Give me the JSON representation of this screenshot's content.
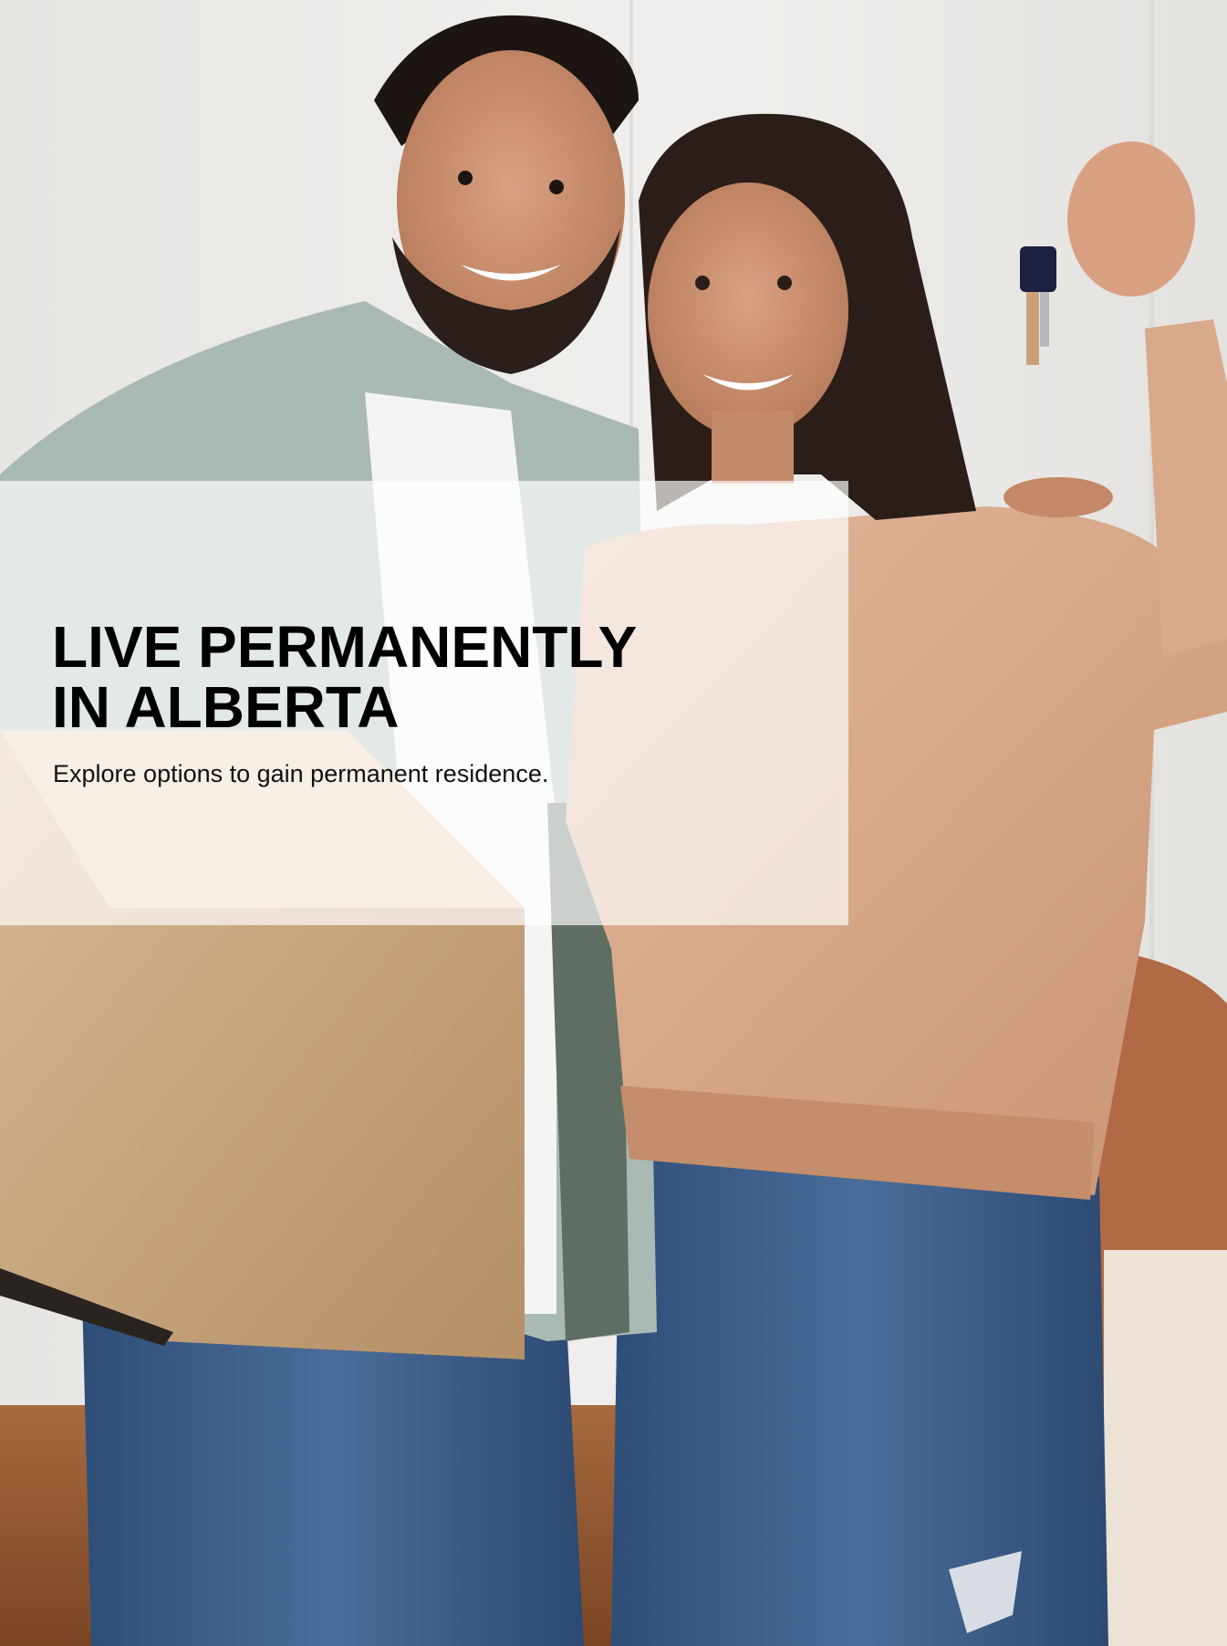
{
  "cover": {
    "headline_line1": "LIVE PERMANENTLY",
    "headline_line2": "IN ALBERTA",
    "subheadline": "Explore options to gain permanent residence."
  },
  "colors": {
    "overlay": "#ffffff",
    "headline_text": "#000000",
    "body_text": "#111111",
    "sweater": "#d9a98a",
    "denim": "#3b5f8c",
    "box": "#c9a883",
    "shirt": "#a8bab3"
  }
}
